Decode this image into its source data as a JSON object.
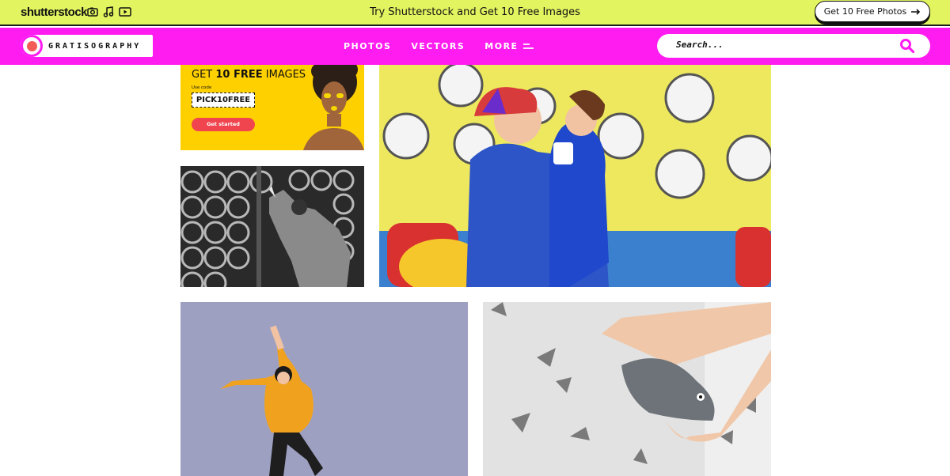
{
  "promo": {
    "logo": "shutterstock",
    "icons": [
      "camera-icon",
      "music-icon",
      "play-icon"
    ],
    "text": "Try Shutterstock and Get 10 Free Images",
    "cta": "Get 10 Free Photos"
  },
  "nav": {
    "brand": "GRATISOGRAPHY",
    "links": [
      {
        "label": "PHOTOS"
      },
      {
        "label": "VECTORS"
      },
      {
        "label": "MORE"
      }
    ],
    "search": {
      "placeholder": "Search..."
    }
  },
  "ad": {
    "title_prefix": "GET ",
    "title_bold": "10 FREE",
    "title_suffix": " IMAGES",
    "sub": "Use code",
    "code": "PICK10FREE",
    "cta": "Get started"
  },
  "colors": {
    "promo_bg": "#e2f460",
    "nav_bg": "#ff1cf0",
    "brand_dot": "#f25b56",
    "ad_bg": "#ffd000",
    "ad_cta": "#f0454f"
  }
}
